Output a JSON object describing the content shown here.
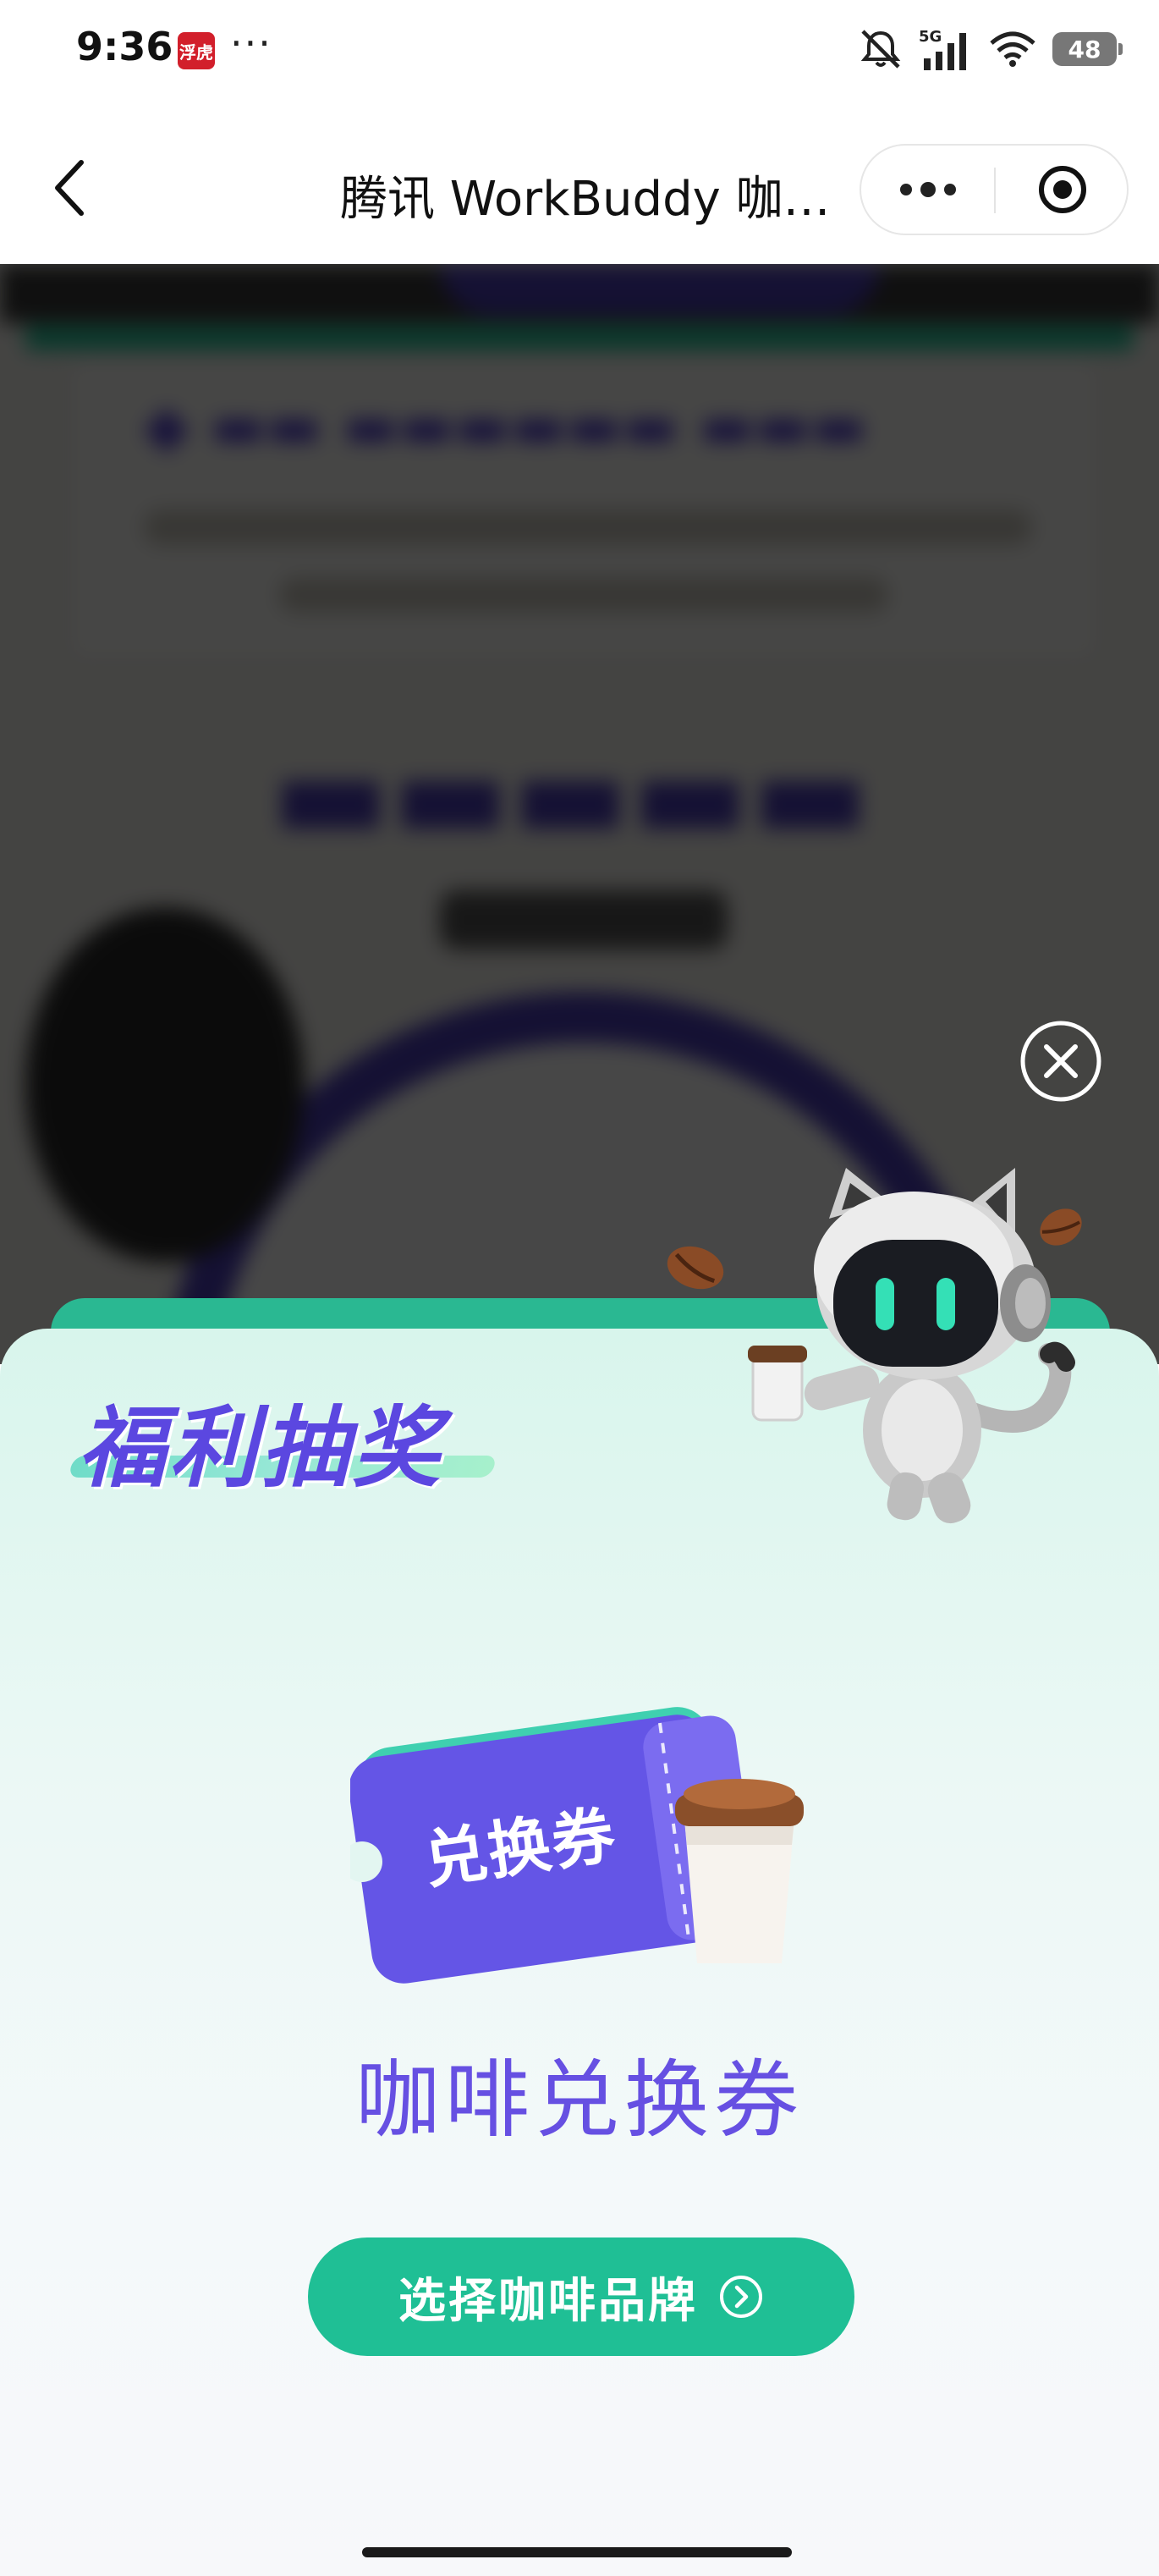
{
  "status_bar": {
    "time": "9:36",
    "app_badge": "浮虎",
    "more": "···",
    "network": "5G",
    "battery": "48"
  },
  "nav": {
    "title": "腾讯 WorkBuddy 咖…"
  },
  "sheet": {
    "title": "福利抽奖",
    "ticket_label": "兑换券",
    "prize_name": "咖啡兑换券",
    "cta_label": "选择咖啡品牌"
  },
  "colors": {
    "accent_purple": "#5b47e0",
    "accent_green": "#1fbf95",
    "sheet_top": "#d8f5ec",
    "overlay": "rgba(0,0,0,0.72)"
  },
  "icons": [
    "back-arrow-icon",
    "more-dots-icon",
    "target-icon",
    "close-circle-icon",
    "arrow-circle-right-icon",
    "robot-cat-mascot",
    "coffee-bean-icon",
    "coupon-ticket-illustration",
    "coffee-cup-icon",
    "mute-icon",
    "signal-icon",
    "wifi-icon",
    "battery-icon"
  ]
}
